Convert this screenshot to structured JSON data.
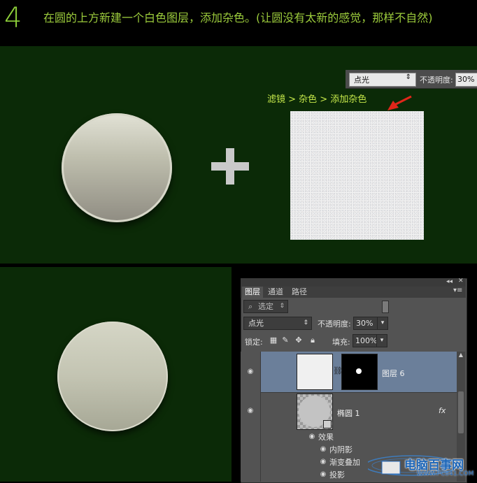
{
  "header": {
    "step_number": "4",
    "instruction": "在圆的上方新建一个白色图层，添加杂色。(让圆没有太新的感觉，那样不自然)"
  },
  "top_panel": {
    "filter_path": "滤镜 > 杂色 > 添加杂色",
    "blend_mode": "点光",
    "opacity_label": "不透明度:",
    "opacity_value": "30%"
  },
  "layers_panel": {
    "tabs": [
      {
        "label": "图层",
        "active": true
      },
      {
        "label": "通道",
        "active": false
      },
      {
        "label": "路径",
        "active": false
      }
    ],
    "filter_placeholder": "选定",
    "blend_mode": "点光",
    "opacity_label": "不透明度:",
    "opacity_value": "30%",
    "lock_label": "锁定:",
    "fill_label": "填充:",
    "fill_value": "100%",
    "layers": [
      {
        "name": "图层 6",
        "selected": true,
        "has_mask": true
      },
      {
        "name": "椭圆 1",
        "selected": false,
        "fx": "fx"
      }
    ],
    "effects_label": "效果",
    "effects": [
      "内阴影",
      "渐变叠加",
      "投影"
    ]
  },
  "watermark": {
    "brand": "电脑百事网",
    "url": "WWW.PC841.COM"
  },
  "colors": {
    "header_text": "#9ccc3c",
    "panel_green": "#0b2a07",
    "selected_layer": "#6b7f9a",
    "arrow_red": "#e0261a",
    "filter_text": "#c6e84a"
  }
}
